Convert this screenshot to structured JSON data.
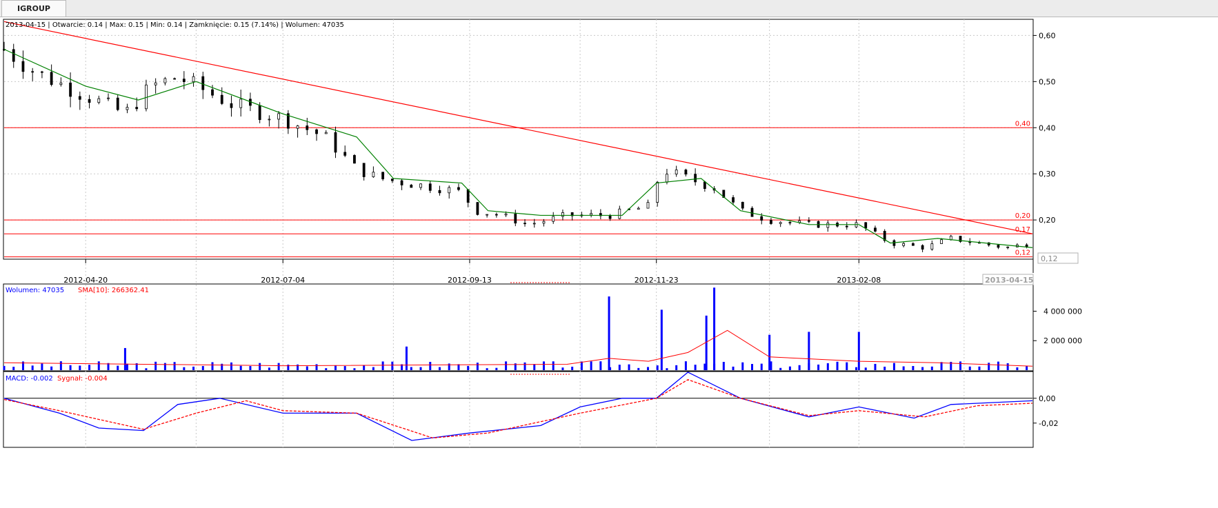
{
  "tab": {
    "title": "IGROUP"
  },
  "price_panel": {
    "info": "2013-04-15 | Otwarcie: 0.14 | Max: 0.15 | Min: 0.14 | Zamknięcie: 0.15 (7.14%) | Wolumen: 47035",
    "current_price_label": "0,12",
    "current_date_label": "2013-04-15"
  },
  "volume_panel": {
    "label_volume": "Wolumen: 47035",
    "label_sma": "SMA[10]: 266362.41"
  },
  "macd_panel": {
    "label_macd": "MACD: -0.002",
    "label_signal": "Sygnał: -0.004"
  },
  "colors": {
    "up": "#ffffff",
    "down": "#000000",
    "sma": "#008000",
    "line": "#ff0000",
    "volume": "#0000ff",
    "grid": "#c8c8c8"
  },
  "chart_data": [
    {
      "type": "candlestick",
      "title": "IGROUP",
      "x_ticks": [
        "2012-04-20",
        "2012-07-04",
        "2012-09-13",
        "2012-11-23",
        "2013-02-08"
      ],
      "y_ticks": [
        0.6,
        0.5,
        0.4,
        0.3,
        0.2
      ],
      "y_tick_labels": [
        "0,60",
        "0,50",
        "0,40",
        "0,30",
        "0,20"
      ],
      "ylim": [
        0.115,
        0.635
      ],
      "x_range": [
        "2012-03-20",
        "2013-04-15"
      ],
      "horizontal_lines": [
        {
          "value": 0.4,
          "label": "0,40"
        },
        {
          "value": 0.2,
          "label": "0,20"
        },
        {
          "value": 0.17,
          "label": "0,17"
        },
        {
          "value": 0.12,
          "label": "0,12"
        }
      ],
      "trend_line": {
        "start": [
          "2012-03-20",
          0.63
        ],
        "end": [
          "2013-04-15",
          0.17
        ]
      },
      "series": [
        {
          "name": "close",
          "dates": [
            "2012-03-20",
            "2012-04-01",
            "2012-04-20",
            "2012-05-05",
            "2012-05-15",
            "2012-05-25",
            "2012-06-01",
            "2012-06-15",
            "2012-07-04",
            "2012-07-20",
            "2012-08-01",
            "2012-08-10",
            "2012-08-20",
            "2012-09-01",
            "2012-09-10",
            "2012-09-15",
            "2012-09-25",
            "2012-10-05",
            "2012-10-20",
            "2012-11-05",
            "2012-11-20",
            "2012-11-25",
            "2012-12-05",
            "2012-12-15",
            "2012-12-25",
            "2013-01-05",
            "2013-01-20",
            "2013-02-08",
            "2013-02-20",
            "2013-03-05",
            "2013-03-15",
            "2013-03-25",
            "2013-04-05",
            "2013-04-15"
          ],
          "values": [
            0.57,
            0.52,
            0.47,
            0.43,
            0.49,
            0.51,
            0.49,
            0.45,
            0.42,
            0.38,
            0.31,
            0.29,
            0.28,
            0.27,
            0.26,
            0.22,
            0.21,
            0.19,
            0.21,
            0.21,
            0.23,
            0.31,
            0.29,
            0.27,
            0.22,
            0.2,
            0.19,
            0.19,
            0.15,
            0.14,
            0.16,
            0.15,
            0.14,
            0.15
          ]
        },
        {
          "name": "sma",
          "dates": [
            "2012-03-20",
            "2012-04-20",
            "2012-05-10",
            "2012-06-01",
            "2012-07-04",
            "2012-08-01",
            "2012-08-15",
            "2012-09-10",
            "2012-09-20",
            "2012-10-10",
            "2012-11-10",
            "2012-11-23",
            "2012-12-10",
            "2012-12-25",
            "2013-01-20",
            "2013-02-08",
            "2013-02-20",
            "2013-03-10",
            "2013-04-15"
          ],
          "values": [
            0.57,
            0.49,
            0.46,
            0.5,
            0.43,
            0.38,
            0.29,
            0.28,
            0.22,
            0.21,
            0.21,
            0.28,
            0.29,
            0.22,
            0.19,
            0.19,
            0.15,
            0.16,
            0.14
          ]
        }
      ]
    },
    {
      "type": "bar",
      "title": "Wolumen",
      "y_ticks": [
        4000000,
        2000000
      ],
      "y_tick_labels": [
        "4 000 000",
        "2 000 000"
      ],
      "ylim": [
        0,
        5800000
      ],
      "series": [
        {
          "name": "Wolumen",
          "notable": [
            {
              "date": "2012-11-05",
              "value": 5000000
            },
            {
              "date": "2012-11-25",
              "value": 4100000
            },
            {
              "date": "2012-12-15",
              "value": 5600000
            },
            {
              "date": "2012-12-12",
              "value": 3700000
            },
            {
              "date": "2013-01-05",
              "value": 2400000
            },
            {
              "date": "2013-01-20",
              "value": 2600000
            },
            {
              "date": "2013-02-08",
              "value": 2600000
            },
            {
              "date": "2012-05-05",
              "value": 1500000
            },
            {
              "date": "2012-08-20",
              "value": 1600000
            }
          ]
        },
        {
          "name": "SMA[10]",
          "dates": [
            "2012-03-20",
            "2012-07-04",
            "2012-10-20",
            "2012-11-05",
            "2012-11-20",
            "2012-12-05",
            "2012-12-20",
            "2013-01-05",
            "2013-02-08",
            "2013-03-10",
            "2013-04-15"
          ],
          "values": [
            500000,
            300000,
            400000,
            800000,
            600000,
            1200000,
            2700000,
            900000,
            600000,
            500000,
            270000
          ]
        }
      ]
    },
    {
      "type": "line",
      "title": "MACD",
      "y_ticks": [
        0.0,
        -0.02
      ],
      "y_tick_labels": [
        "0,00",
        "-0,02"
      ],
      "ylim": [
        -0.039,
        0.021
      ],
      "series": [
        {
          "name": "MACD",
          "dates": [
            "2012-03-20",
            "2012-04-10",
            "2012-04-25",
            "2012-05-12",
            "2012-05-25",
            "2012-06-10",
            "2012-07-04",
            "2012-08-01",
            "2012-08-22",
            "2012-09-13",
            "2012-10-10",
            "2012-10-25",
            "2012-11-10",
            "2012-11-23",
            "2012-12-05",
            "2012-12-25",
            "2013-01-20",
            "2013-02-08",
            "2013-03-01",
            "2013-03-15",
            "2013-04-15"
          ],
          "values": [
            0.0,
            -0.012,
            -0.024,
            -0.026,
            -0.005,
            0.0,
            -0.012,
            -0.012,
            -0.034,
            -0.028,
            -0.022,
            -0.007,
            0.0,
            0.0,
            0.021,
            0.0,
            -0.015,
            -0.007,
            -0.016,
            -0.005,
            -0.002
          ]
        },
        {
          "name": "Sygnał",
          "dates": [
            "2012-03-20",
            "2012-04-10",
            "2012-05-12",
            "2012-06-01",
            "2012-06-20",
            "2012-07-04",
            "2012-08-01",
            "2012-08-30",
            "2012-09-20",
            "2012-10-25",
            "2012-11-23",
            "2012-12-05",
            "2012-12-25",
            "2013-01-20",
            "2013-02-08",
            "2013-03-05",
            "2013-03-25",
            "2013-04-15"
          ],
          "values": [
            -0.001,
            -0.01,
            -0.025,
            -0.012,
            -0.002,
            -0.01,
            -0.012,
            -0.032,
            -0.028,
            -0.012,
            0.0,
            0.015,
            0.0,
            -0.014,
            -0.01,
            -0.015,
            -0.006,
            -0.004
          ]
        }
      ]
    }
  ]
}
